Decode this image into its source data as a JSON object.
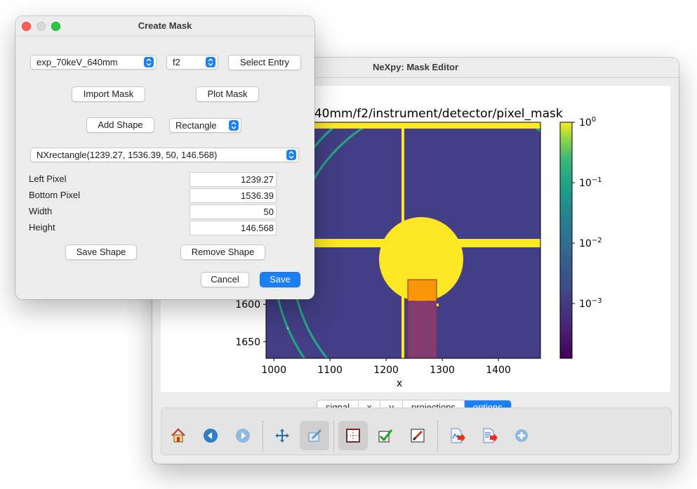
{
  "editor": {
    "title": "NeXpy: Mask Editor",
    "plot_title": "640mm/f2/instrument/detector/pixel_mask",
    "tabs": [
      {
        "label": "signal",
        "active": false
      },
      {
        "label": "x",
        "active": false
      },
      {
        "label": "y",
        "active": false
      },
      {
        "label": "projections",
        "active": false
      },
      {
        "label": "options",
        "active": true
      }
    ],
    "toolbar": [
      {
        "name": "home-icon",
        "pressed": false
      },
      {
        "name": "back-icon",
        "pressed": false
      },
      {
        "name": "forward-icon",
        "pressed": false
      },
      {
        "name": "pan-icon",
        "pressed": false
      },
      {
        "name": "edit-icon",
        "pressed": true
      },
      {
        "name": "aspect-icon",
        "pressed": true
      },
      {
        "name": "checkmark-icon",
        "pressed": false
      },
      {
        "name": "brush-icon",
        "pressed": false
      },
      {
        "name": "export-plot-icon",
        "pressed": false
      },
      {
        "name": "export-data-icon",
        "pressed": false
      },
      {
        "name": "add-icon",
        "pressed": false
      }
    ]
  },
  "chart_data": {
    "type": "heatmap",
    "title": "640mm/f2/instrument/detector/pixel_mask",
    "xlabel": "x",
    "ylabel": "",
    "xlim": [
      986,
      1475
    ],
    "ylim": [
      1672,
      1357
    ],
    "xticks": [
      1000,
      1100,
      1200,
      1300,
      1400
    ],
    "yticks": [
      1600,
      1650
    ],
    "colorbar": {
      "scale": "log",
      "ticks": [
        "10^0",
        "10^-1",
        "10^-2",
        "10^-3"
      ],
      "colormap": "viridis"
    },
    "mask_rectangle": {
      "left": 1239.27,
      "bottom": 1536.39,
      "width": 50,
      "height": 146.568
    }
  },
  "dialog": {
    "title": "Create Mask",
    "entry_select": "exp_70keV_640mm",
    "subentry_select": "f2",
    "select_entry_label": "Select Entry",
    "import_mask_label": "Import Mask",
    "plot_mask_label": "Plot Mask",
    "add_shape_label": "Add Shape",
    "shape_type_select": "Rectangle",
    "shape_select": "NXrectangle(1239.27, 1536.39, 50, 146.568)",
    "fields": [
      {
        "label": "Left Pixel",
        "value": "1239.27"
      },
      {
        "label": "Bottom Pixel",
        "value": "1536.39"
      },
      {
        "label": "Width",
        "value": "50"
      },
      {
        "label": "Height",
        "value": "146.568"
      }
    ],
    "save_shape_label": "Save Shape",
    "remove_shape_label": "Remove Shape",
    "cancel_label": "Cancel",
    "save_label": "Save"
  },
  "colors": {
    "accent": "#1b7ff5",
    "mask_yellow": "#fde725",
    "background_purple": "#433e85",
    "ring": "#24a884",
    "selection": "#ff9a00"
  }
}
